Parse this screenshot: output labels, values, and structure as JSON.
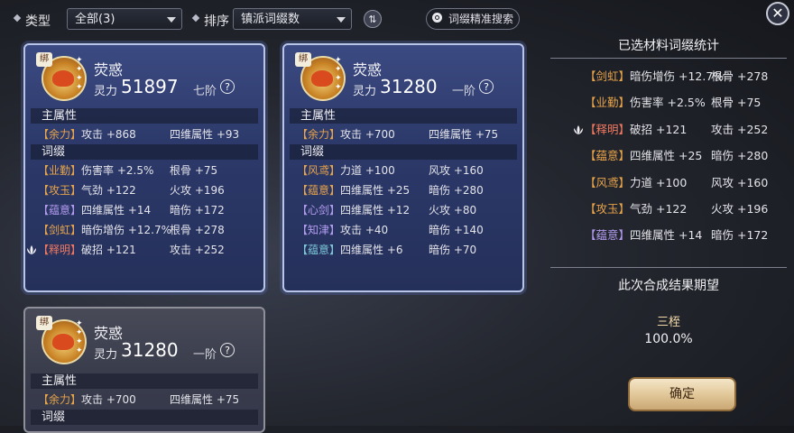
{
  "toolbar": {
    "type_label": "类型",
    "type_value": "全部(3)",
    "sort_label": "排序",
    "sort_value": "镇派词缀数",
    "search_label": "词缀精准搜索"
  },
  "cards": [
    {
      "bind": "绑",
      "name": "荧惑",
      "power_label": "灵力",
      "power": "51897",
      "rank": "七阶",
      "main_title": "主属性",
      "main": {
        "tag": "【余力】",
        "stat": "攻击 +868",
        "stat2": "四维属性 +93"
      },
      "affix_title": "词缀",
      "affixes": [
        {
          "tag": "【业勤】",
          "stat": "伤害率 +2.5%",
          "stat2": "根骨 +75",
          "color": "#e8a44a",
          "lotus": false
        },
        {
          "tag": "【攻玉】",
          "stat": "气劲 +122",
          "stat2": "火攻 +196",
          "color": "#e8a44a",
          "lotus": false
        },
        {
          "tag": "【蕴意】",
          "stat": "四维属性 +14",
          "stat2": "暗伤 +172",
          "color": "#b39cf0",
          "lotus": false
        },
        {
          "tag": "【剑虹】",
          "stat": "暗伤增伤 +12.7%",
          "stat2": "根骨 +278",
          "color": "#e8a44a",
          "lotus": false
        },
        {
          "tag": "【释明】",
          "stat": "破招 +121",
          "stat2": "攻击 +252",
          "color": "#f07860",
          "lotus": true
        }
      ]
    },
    {
      "bind": "绑",
      "name": "荧惑",
      "power_label": "灵力",
      "power": "31280",
      "rank": "一阶",
      "main_title": "主属性",
      "main": {
        "tag": "【余力】",
        "stat": "攻击 +700",
        "stat2": "四维属性 +75"
      },
      "affix_title": "词缀",
      "affixes": [
        {
          "tag": "【风鸢】",
          "stat": "力道 +100",
          "stat2": "风攻 +160",
          "color": "#e8a44a",
          "lotus": false
        },
        {
          "tag": "【蕴意】",
          "stat": "四维属性 +25",
          "stat2": "暗伤 +280",
          "color": "#e8a44a",
          "lotus": false
        },
        {
          "tag": "【心剑】",
          "stat": "四维属性 +12",
          "stat2": "火攻 +80",
          "color": "#b39cf0",
          "lotus": false
        },
        {
          "tag": "【知津】",
          "stat": "攻击 +40",
          "stat2": "暗伤 +140",
          "color": "#b39cf0",
          "lotus": false
        },
        {
          "tag": "【蕴意】",
          "stat": "四维属性 +6",
          "stat2": "暗伤 +70",
          "color": "#7cc8d8",
          "lotus": false
        }
      ]
    },
    {
      "bind": "绑",
      "name": "荧惑",
      "power_label": "灵力",
      "power": "31280",
      "rank": "一阶",
      "main_title": "主属性",
      "main": {
        "tag": "【余力】",
        "stat": "攻击 +700",
        "stat2": "四维属性 +75"
      },
      "affix_title": "词缀"
    }
  ],
  "panel": {
    "title": "已选材料词缀统计",
    "rows": [
      {
        "tag": "【剑虹】",
        "stat": "暗伤增伤 +12.7%",
        "stat2": "根骨 +278",
        "color": "#e8a44a",
        "lotus": false
      },
      {
        "tag": "【业勤】",
        "stat": "伤害率 +2.5%",
        "stat2": "根骨 +75",
        "color": "#e8a44a",
        "lotus": false
      },
      {
        "tag": "【释明】",
        "stat": "破招 +121",
        "stat2": "攻击 +252",
        "color": "#f07860",
        "lotus": true
      },
      {
        "tag": "【蕴意】",
        "stat": "四维属性 +25",
        "stat2": "暗伤 +280",
        "color": "#e8a44a",
        "lotus": false
      },
      {
        "tag": "【风鸢】",
        "stat": "力道 +100",
        "stat2": "风攻 +160",
        "color": "#e8a44a",
        "lotus": false
      },
      {
        "tag": "【攻玉】",
        "stat": "气劲 +122",
        "stat2": "火攻 +196",
        "color": "#e8a44a",
        "lotus": false
      },
      {
        "tag": "【蕴意】",
        "stat": "四维属性 +14",
        "stat2": "暗伤 +172",
        "color": "#b39cf0",
        "lotus": false
      }
    ],
    "result_title": "此次合成结果期望",
    "result_name": "三桎",
    "result_pct": "100.0%",
    "confirm": "确定"
  }
}
